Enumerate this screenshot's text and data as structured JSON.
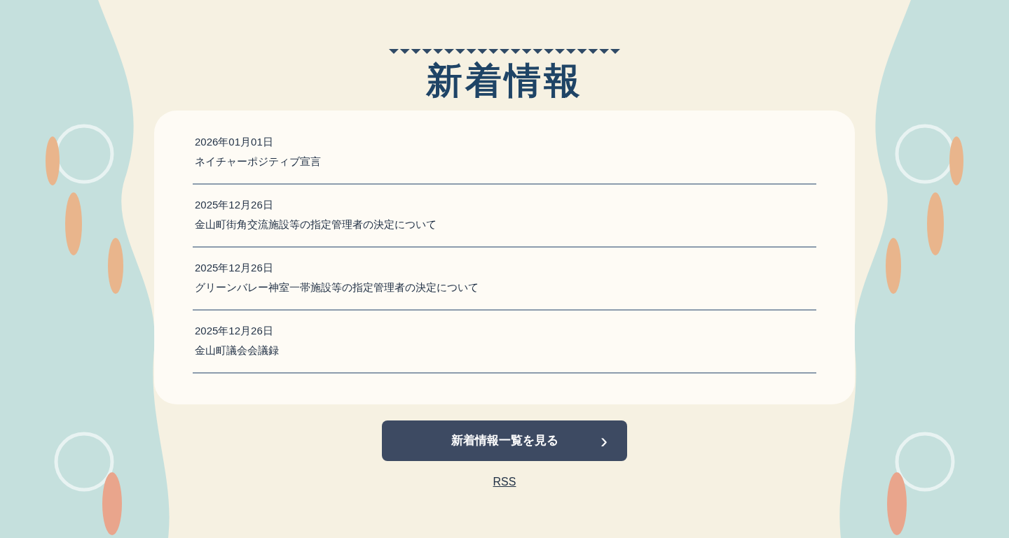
{
  "heading": "新着情報",
  "news": [
    {
      "date": "2026年01月01日",
      "title": "ネイチャーポジティブ宣言"
    },
    {
      "date": "2025年12月26日",
      "title": "金山町街角交流施設等の指定管理者の決定について"
    },
    {
      "date": "2025年12月26日",
      "title": "グリーンバレー神室一帯施設等の指定管理者の決定について"
    },
    {
      "date": "2025年12月26日",
      "title": "金山町議会会議録"
    }
  ],
  "more_button": {
    "label": "新着情報一覧を見る",
    "icon": "›"
  },
  "rss_link": "RSS"
}
